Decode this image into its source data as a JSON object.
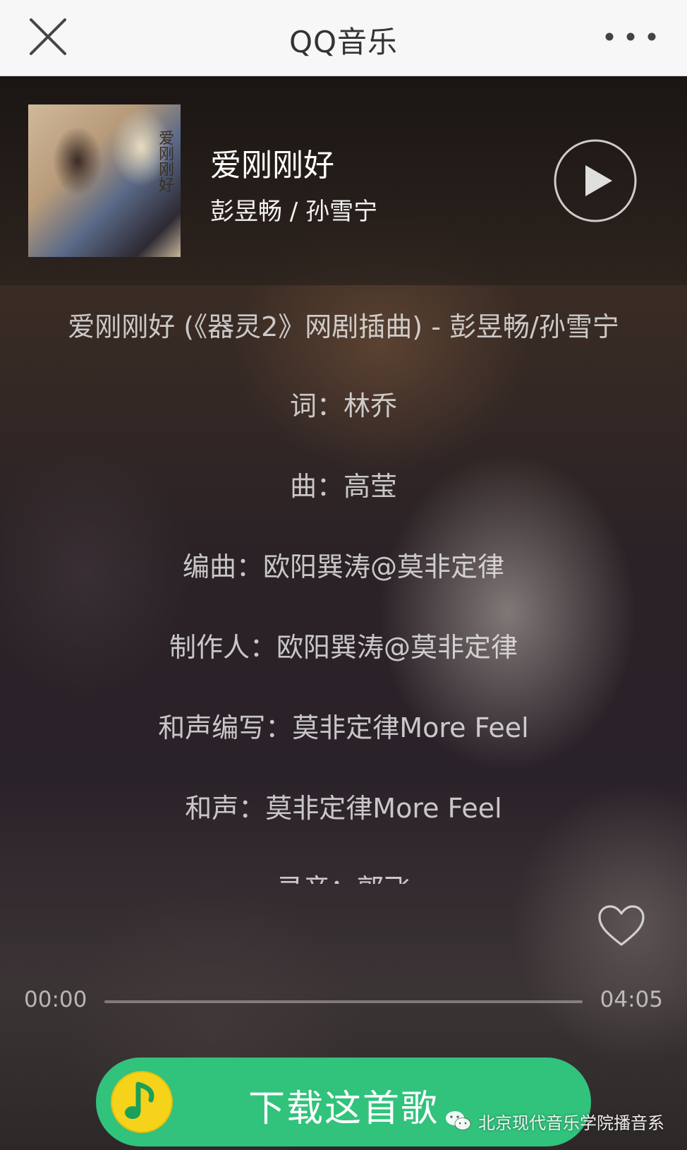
{
  "nav": {
    "title": "QQ音乐",
    "close_icon": "close-icon",
    "more_icon": "more-icon"
  },
  "song": {
    "title": "爱刚刚好",
    "artist": "彭昱畅 / 孙雪宁",
    "cover_text": "爱刚刚好"
  },
  "lyrics": [
    "爱刚刚好 (《器灵2》网剧插曲) - 彭昱畅/孙雪宁",
    "词：林乔",
    "曲：高莹",
    "编曲：欧阳巽涛@莫非定律",
    "制作人：欧阳巽涛@莫非定律",
    "和声编写：莫非定律More Feel",
    "和声：莫非定律More Feel",
    "录音：郭飞"
  ],
  "player": {
    "current_time": "00:00",
    "total_time": "04:05",
    "progress": 0,
    "play_icon": "play-icon",
    "like_icon": "heart-icon"
  },
  "download": {
    "label": "下载这首歌",
    "icon": "qq-music-logo-icon",
    "color": "#31c27c"
  },
  "watermark": {
    "text": "北京现代音乐学院播音系",
    "icon": "wechat-icon"
  }
}
